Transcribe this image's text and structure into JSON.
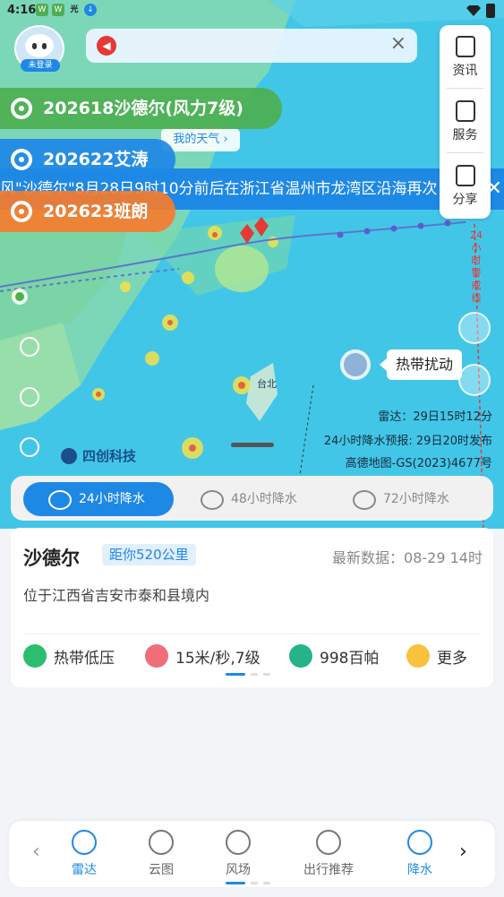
{
  "status_bar": {
    "time": "4:16",
    "icons": [
      "wechat-icon",
      "wechat-icon",
      "flash-icon",
      "download-icon"
    ],
    "flash_label": "光"
  },
  "avatar": {
    "login_label": "未登录"
  },
  "notice": {
    "text": ""
  },
  "typhoons": [
    {
      "label": "202618沙德尔(风力7级)",
      "color": "#4caf50"
    },
    {
      "label": "202622艾涛",
      "color": "#1e88e5"
    },
    {
      "label": "202623班朗",
      "color": "#f57c2d"
    }
  ],
  "my_weather": "我的天气",
  "ticker": "风\"沙德尔\"8月28日9时10分前后在浙江省温州市龙湾区沿海再次",
  "side_panel": {
    "news": "资讯",
    "service": "服务",
    "share": "分享"
  },
  "warning_line": "24小时警戒线",
  "disturbance": "热带扰动",
  "map_info": {
    "radar": "雷达：29日15时12分",
    "forecast": "24小时降水预报: 29日20时发布",
    "copyright": "高德地图-GS(2023)4677号"
  },
  "logo": "四创科技",
  "precip_tabs": [
    {
      "label": "24小时降水",
      "num": "24",
      "active": true
    },
    {
      "label": "48小时降水",
      "num": "48",
      "active": false
    },
    {
      "label": "72小时降水",
      "num": "72",
      "active": false
    }
  ],
  "card": {
    "name": "沙德尔",
    "distance": "距你520公里",
    "updated": "最新数据：08-29 14时",
    "location": "位于江西省吉安市泰和县境内",
    "stats": [
      {
        "label": "热带低压",
        "icon": "tropical-depression-icon",
        "color": "#2dbd6e"
      },
      {
        "label": "15米/秒,7级",
        "icon": "wind-speed-icon",
        "color": "#f06e7a"
      },
      {
        "label": "998百帕",
        "icon": "pressure-icon",
        "color": "#26b38a"
      },
      {
        "label": "更多",
        "icon": "more-icon",
        "color": "#f7c23c"
      }
    ]
  },
  "bottom_nav": [
    {
      "label": "雷达",
      "icon": "radar-icon",
      "active": true
    },
    {
      "label": "云图",
      "icon": "satellite-icon",
      "active": false
    },
    {
      "label": "风场",
      "icon": "wind-field-icon",
      "active": false
    },
    {
      "label": "出行推荐",
      "icon": "map-icon",
      "active": false
    },
    {
      "label": "降水",
      "icon": "rain-icon",
      "active": true
    }
  ],
  "map_labels": {
    "taipei": "台北"
  }
}
